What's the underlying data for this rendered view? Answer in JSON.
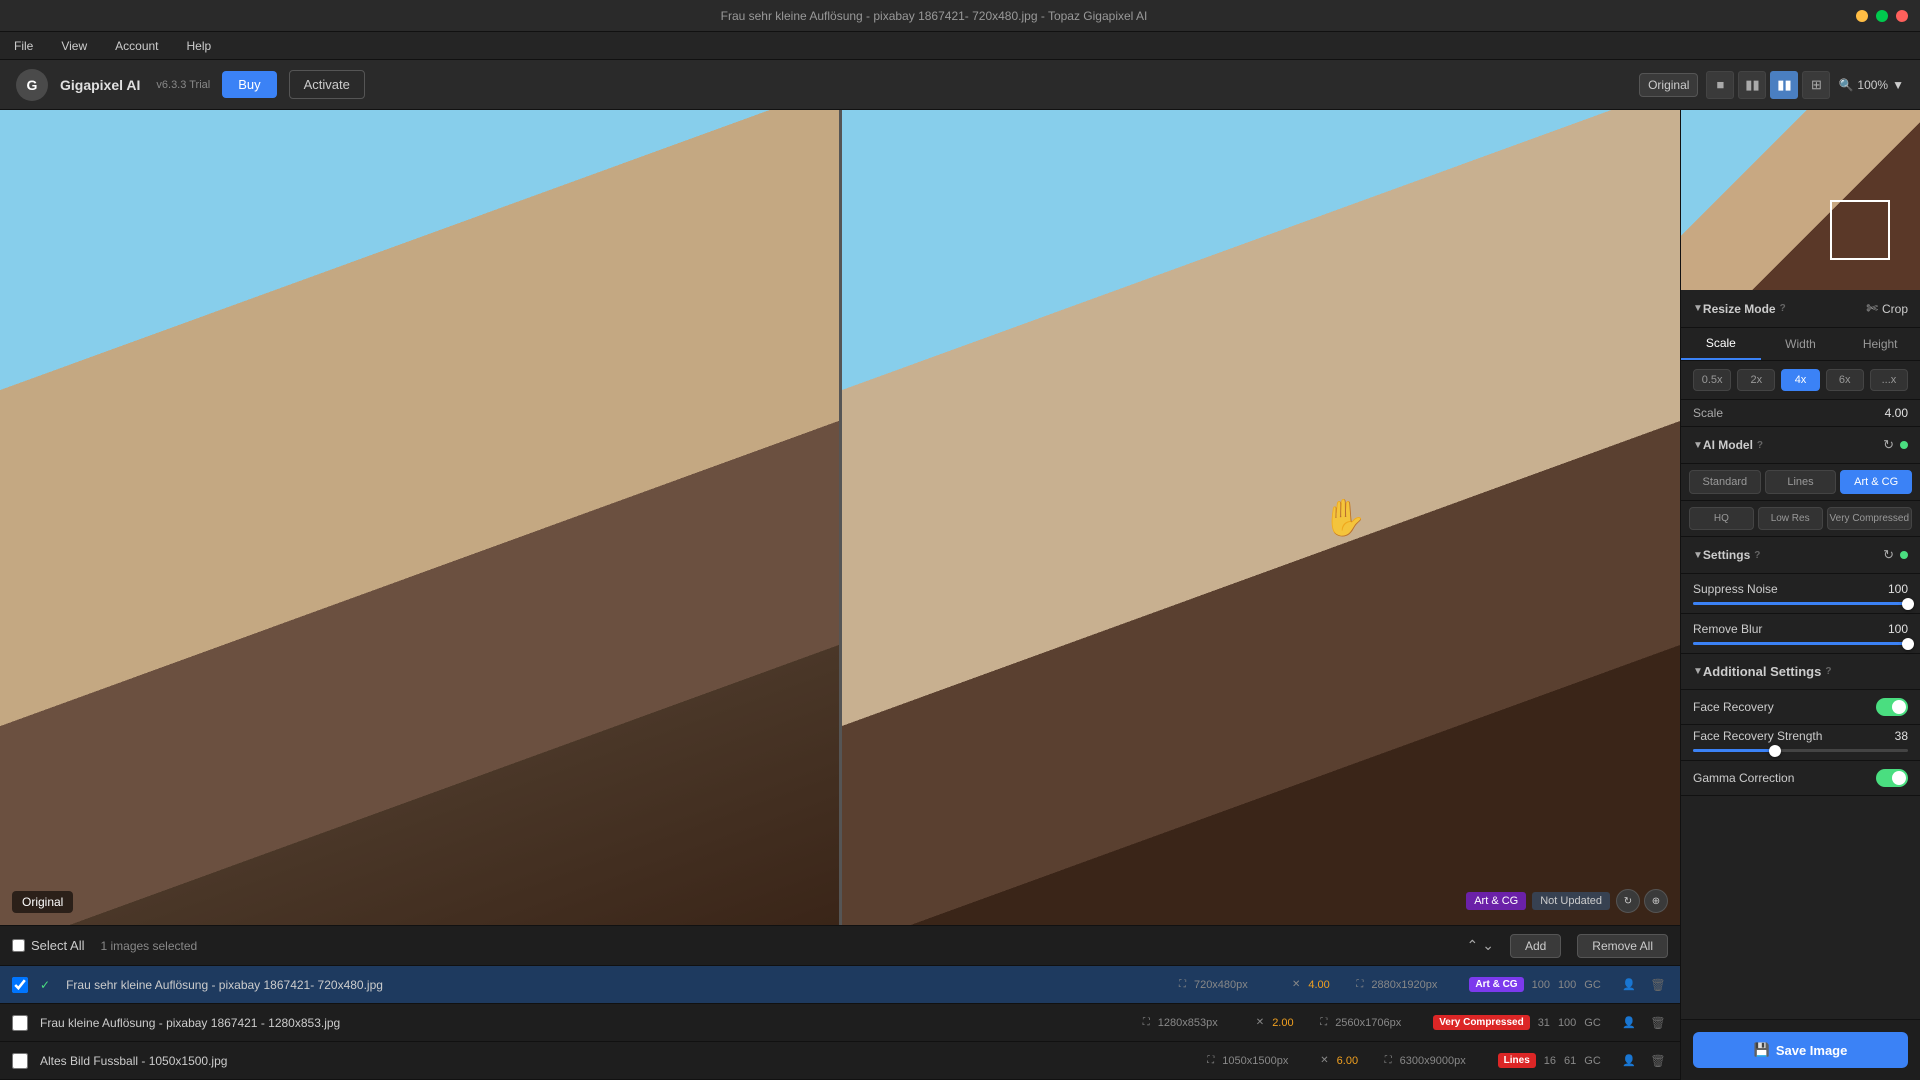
{
  "window": {
    "title": "Frau sehr kleine Auflösung - pixabay 1867421- 720x480.jpg - Topaz Gigapixel AI"
  },
  "titlebar": {
    "close": "×",
    "minimize": "−",
    "maximize": "□"
  },
  "menubar": {
    "items": [
      "File",
      "View",
      "Account",
      "Help"
    ]
  },
  "toolbar": {
    "logo": "G",
    "app_name": "Gigapixel AI",
    "version": "v6.3.3 Trial",
    "btn_buy": "Buy",
    "btn_activate": "Activate",
    "view_original": "Original",
    "zoom": "100%"
  },
  "right_panel": {
    "resize_mode": {
      "label": "Resize Mode",
      "help": "?",
      "crop_label": "Crop"
    },
    "scale_tabs": [
      "Scale",
      "Width",
      "Height"
    ],
    "scale_presets": [
      "0.5x",
      "2x",
      "4x",
      "6x",
      "...x"
    ],
    "scale_label": "Scale",
    "scale_value": "4.00",
    "ai_model": {
      "label": "AI Model",
      "help": "?",
      "models": [
        "Standard",
        "Lines",
        "Art & CG"
      ],
      "qualities": [
        "HQ",
        "Low Res",
        "Very Compressed"
      ]
    },
    "settings": {
      "label": "Settings",
      "help": "?",
      "suppress_noise": {
        "label": "Suppress Noise",
        "value": 100,
        "pct": 100
      },
      "remove_blur": {
        "label": "Remove Blur",
        "value": 100,
        "pct": 100
      }
    },
    "additional_settings": {
      "label": "Additional Settings",
      "help": "?"
    },
    "face_recovery": {
      "label": "Face Recovery",
      "enabled": true
    },
    "face_recovery_strength": {
      "label": "Face Recovery Strength",
      "value": 38,
      "pct": 38
    },
    "gamma_correction": {
      "label": "Gamma Correction",
      "enabled": true
    },
    "save_btn": "Save Image"
  },
  "image_area": {
    "original_label": "Original",
    "badge_art_cg": "Art & CG",
    "badge_not_updated": "Not Updated"
  },
  "file_list": {
    "select_all": "Select All",
    "selected_count": "1 images selected",
    "btn_add": "Add",
    "btn_remove_all": "Remove All",
    "files": [
      {
        "name": "Frau sehr kleine Auflösung - pixabay 1867421- 720x480.jpg",
        "selected": true,
        "orig_size": "720x480px",
        "scale": "4.00",
        "out_size": "2880x1920px",
        "model": "Art & CG",
        "model_class": "art-cg",
        "noise": "100",
        "blur": "100",
        "gc": "GC"
      },
      {
        "name": "Frau kleine Auflösung - pixabay 1867421 - 1280x853.jpg",
        "selected": false,
        "orig_size": "1280x853px",
        "scale": "2.00",
        "out_size": "2560x1706px",
        "model": "Very Compressed",
        "model_class": "very-compressed",
        "noise": "31",
        "blur": "100",
        "gc": "GC"
      },
      {
        "name": "Altes Bild Fussball - 1050x1500.jpg",
        "selected": false,
        "orig_size": "1050x1500px",
        "scale": "6.00",
        "out_size": "6300x9000px",
        "model": "Lines",
        "model_class": "lines",
        "noise": "16",
        "blur": "61",
        "gc": "GC"
      }
    ]
  }
}
